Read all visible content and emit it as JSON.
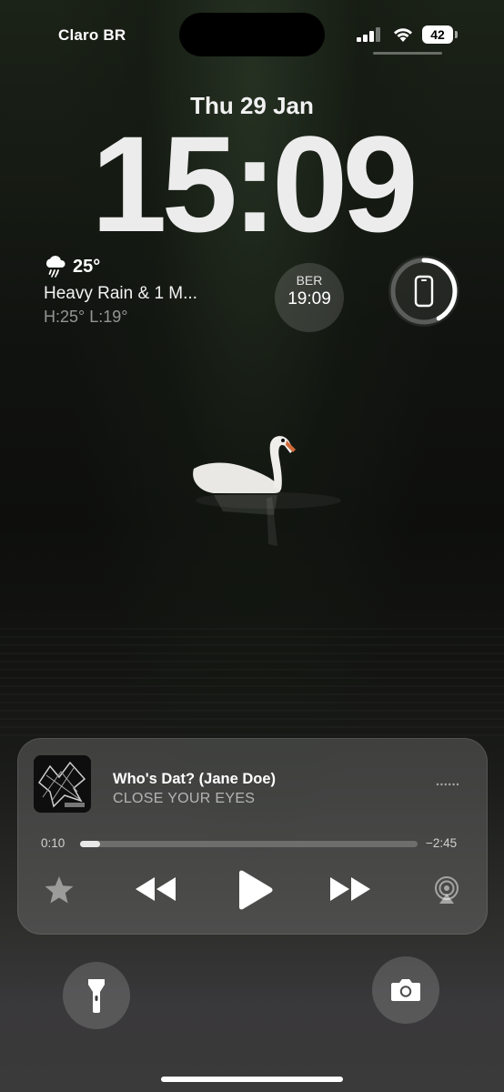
{
  "status_bar": {
    "carrier": "Claro BR",
    "battery_level": "42"
  },
  "lock_screen": {
    "date": "Thu 29 Jan",
    "time": "15:09"
  },
  "widgets": {
    "weather": {
      "icon": "heavy-rain-cloud-icon",
      "temperature": "25°",
      "condition": "Heavy Rain & 1 M...",
      "high_low": "H:25° L:19°"
    },
    "world_clock": {
      "city": "BER",
      "time": "19:09"
    },
    "battery": {
      "icon": "iphone-icon",
      "level_fraction": 0.42
    }
  },
  "now_playing": {
    "title": "Who's Dat? (Jane Doe)",
    "artist": "CLOSE YOUR EYES",
    "elapsed": "0:10",
    "remaining": "−2:45",
    "progress_fraction": 0.06,
    "controls": [
      "star-icon",
      "rewind-icon",
      "play-icon",
      "fast-forward-icon",
      "airplay-icon"
    ]
  },
  "quick_actions": {
    "left": "flashlight-icon",
    "right": "camera-icon"
  }
}
